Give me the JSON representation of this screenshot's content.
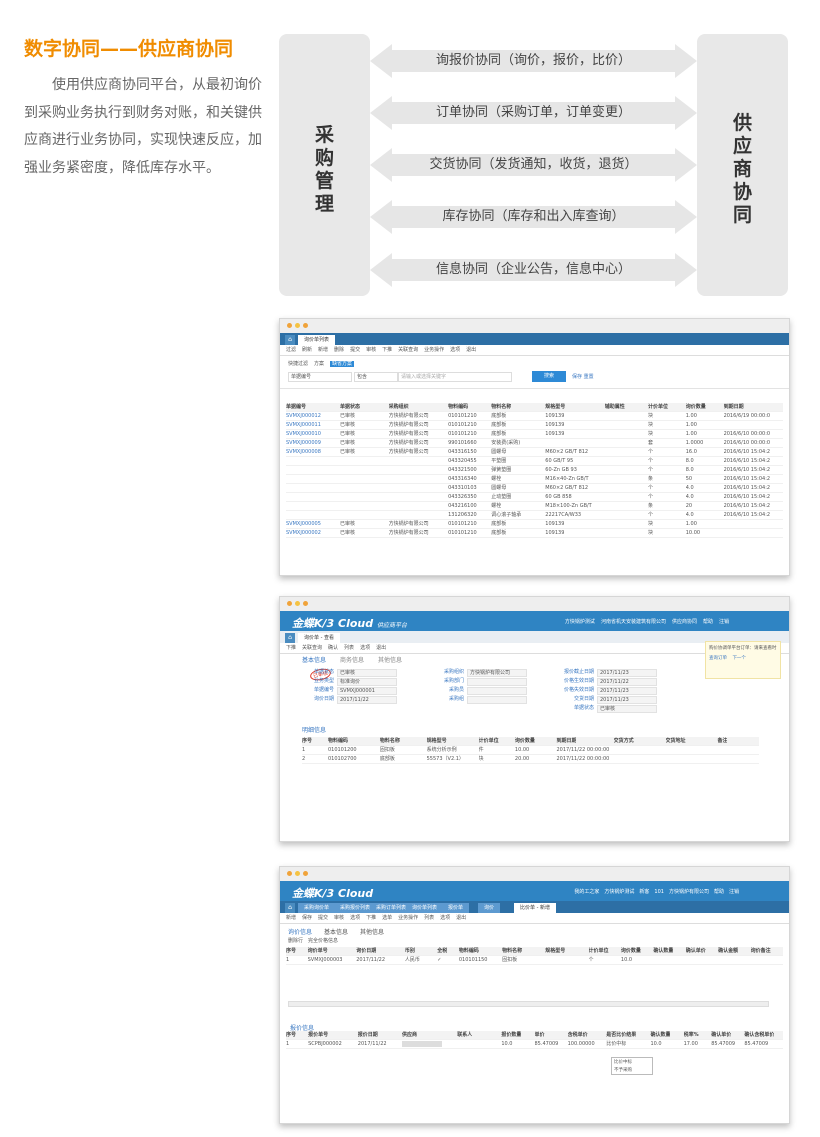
{
  "heading": "数字协同——供应商协同",
  "intro": "使用供应商协同平台，从最初询价到采购业务执行到财务对账，和关键供应商进行业务协同，实现快速反应，加强业务紧密度，降低库存水平。",
  "diagram": {
    "left_label": [
      "采",
      "购",
      "管",
      "理"
    ],
    "right_label": [
      "供",
      "应",
      "商",
      "协",
      "同"
    ],
    "arrows": [
      "询报价协同（询价，报价，比价）",
      "订单协同（采购订单，订单变更）",
      "交货协同（发货通知，收货，退货）",
      "库存协同（库存和出入库查询）",
      "信息协同（企业公告，信息中心）"
    ],
    "colors": {
      "box": "#e8e8e8",
      "arrow": "#e6e6e6",
      "heading": "#f08c00"
    }
  },
  "shot1": {
    "tab_label": "询价单列表",
    "toolbar": [
      "过滤",
      "刷新",
      "新增",
      "删除",
      "提交",
      "审核",
      "下推",
      "关联查询",
      "业务操作",
      "选项",
      "退出"
    ],
    "filter_tabs": [
      "快捷过滤",
      "方案",
      "缺省方案"
    ],
    "filter_field": "单据编号",
    "filter_op": "包含",
    "search_placeholder": "请输入或选择关键字",
    "search_button": "搜索",
    "search_links": [
      "保存",
      "重置"
    ],
    "columns": [
      "单据编号",
      "单据状态",
      "采购组织",
      "物料编码",
      "物料名称",
      "规格型号",
      "辅助属性",
      "计价单位",
      "询价数量",
      "到期日期"
    ],
    "rows": [
      [
        "SVMXJ000012",
        "已审核",
        "方快锅炉有限公司",
        "010101210",
        "底部板",
        "109139",
        "",
        "块",
        "1.00",
        "2016/6/19 00:00:0"
      ],
      [
        "SVMXJ000011",
        "已审核",
        "方快锅炉有限公司",
        "010101210",
        "底部板",
        "109139",
        "",
        "块",
        "1.00",
        ""
      ],
      [
        "SVMXJ000010",
        "已审核",
        "方快锅炉有限公司",
        "010101210",
        "底部板",
        "109139",
        "",
        "块",
        "1.00",
        "2016/6/10 00:00:0"
      ],
      [
        "SVMXJ000009",
        "已审核",
        "方快锅炉有限公司",
        "990101660",
        "安装费(采购)",
        "",
        "",
        "套",
        "1.0000",
        "2016/6/10 00:00:0"
      ],
      [
        "SVMXJ000008",
        "已审核",
        "方快锅炉有限公司",
        "043316150",
        "圆螺母",
        "M60×2 GB/T 812",
        "",
        "个",
        "16.0",
        "2016/6/10 15:04:2"
      ],
      [
        "",
        "",
        "",
        "043320455",
        "平垫圈",
        "60 GB/T 95",
        "",
        "个",
        "8.0",
        "2016/6/10 15:04:2"
      ],
      [
        "",
        "",
        "",
        "043321500",
        "弹簧垫圈",
        "60-Zn GB 93",
        "",
        "个",
        "8.0",
        "2016/6/10 15:04:2"
      ],
      [
        "",
        "",
        "",
        "043316340",
        "螺栓",
        "M16×40-Zn GB/T",
        "",
        "条",
        "50",
        "2016/6/10 15:04:2"
      ],
      [
        "",
        "",
        "",
        "043310103",
        "圆螺母",
        "M60×2 GB/T 812",
        "",
        "个",
        "4.0",
        "2016/6/10 15:04:2"
      ],
      [
        "",
        "",
        "",
        "043326350",
        "止动垫圈",
        "60  GB 858",
        "",
        "个",
        "4.0",
        "2016/6/10 15:04:2"
      ],
      [
        "",
        "",
        "",
        "043216100",
        "螺栓",
        "M18×100-Zn GB/T",
        "",
        "条",
        "20",
        "2016/6/10 15:04:2"
      ],
      [
        "",
        "",
        "",
        "131206320",
        "调心滚子轴承",
        "22217CA/W33",
        "",
        "个",
        "4.0",
        "2016/6/10 15:04:2"
      ],
      [
        "SVMXJ000005",
        "已审核",
        "方快锅炉有限公司",
        "010101210",
        "底部板",
        "109139",
        "",
        "块",
        "1.00",
        ""
      ],
      [
        "SVMXJ000002",
        "已审核",
        "方快锅炉有限公司",
        "010101210",
        "底部板",
        "109139",
        "",
        "块",
        "10.00",
        ""
      ]
    ]
  },
  "shot2": {
    "brand": "金蝶K/3 Cloud",
    "brand_sub": "供应商平台",
    "top_links": [
      "方快锅炉测试",
      "河南省机天安装建筑有限公司",
      "供应商协同",
      "帮助",
      "注销"
    ],
    "tab_label": "询价单 - 查看",
    "toolbar": [
      "下推",
      "关联查询",
      "确认",
      "列表",
      "选项",
      "退出"
    ],
    "section_tabs": [
      "基本信息",
      "商务信息",
      "其他信息"
    ],
    "stamp": "已审核",
    "fields_col1": [
      [
        "单据状态",
        "已审核"
      ],
      [
        "业务类型",
        "标准询价"
      ],
      [
        "单据编号",
        "SVMXJ000001"
      ],
      [
        "询价日期",
        "2017/11/22"
      ]
    ],
    "fields_col2": [
      [
        "采购组织",
        "方快锅炉有限公司"
      ],
      [
        "采购部门",
        ""
      ],
      [
        "采购员",
        ""
      ],
      [
        "采购组",
        ""
      ]
    ],
    "fields_col3": [
      [
        "报价截止日期",
        "2017/11/23"
      ],
      [
        "价格生效日期",
        "2017/11/22"
      ],
      [
        "价格失效日期",
        "2017/11/23"
      ],
      [
        "交货日期",
        "2017/11/23"
      ],
      [
        "单据状态",
        "已审核"
      ]
    ],
    "side_note": "购价协调单平台订单：请来查看时",
    "side_links": [
      "查询订单",
      "下一个"
    ],
    "detail_label": "明细信息",
    "detail_columns": [
      "序号",
      "物料编码",
      "物料名称",
      "规格型号",
      "计价单位",
      "询价数量",
      "到期日期",
      "交货方式",
      "交货地址",
      "备注"
    ],
    "detail_rows": [
      [
        "1",
        "010101200",
        "固扣板",
        "系统分析示例",
        "件",
        "10.00",
        "2017/11/22 00:00:00",
        "",
        "",
        ""
      ],
      [
        "2",
        "010102700",
        "底部板",
        "55573（V2.1）",
        "块",
        "20.00",
        "2017/11/22 00:00:00",
        "",
        "",
        ""
      ]
    ]
  },
  "shot3": {
    "brand": "金蝶K/3 Cloud",
    "top_links": [
      "我的工之家",
      "方快锅炉测试",
      "新客",
      "101",
      "方快锅炉有限公司",
      "帮助",
      "注销"
    ],
    "tabs": [
      "采购询价单",
      "采购报价列表",
      "采购订单列表",
      "询价单列表",
      "报价单",
      "询价",
      "比价单 - 新增"
    ],
    "toolbar": [
      "新增",
      "保存",
      "提交",
      "审核",
      "选项",
      "下推",
      "选单",
      "业务操作",
      "列表",
      "选项",
      "退出"
    ],
    "section_tabs": [
      "询价信息",
      "基本信息",
      "其他信息"
    ],
    "sub_toolbar": [
      "删除行",
      "完全价格信息"
    ],
    "grid1_columns": [
      "序号",
      "询价单号",
      "询价日期",
      "币别",
      "全税",
      "物料编码",
      "物料名称",
      "规格型号",
      "计价单位",
      "询价数量",
      "确认数量",
      "确认单价",
      "确认金额",
      "询价备注"
    ],
    "grid1_row": [
      "1",
      "SVMXJ000003",
      "2017/11/22",
      "人民币",
      "✓",
      "010101150",
      "固扣板",
      "",
      "个",
      "10.0",
      "",
      "",
      "",
      ""
    ],
    "grid2_label": "报价信息",
    "grid2_columns": [
      "序号",
      "报价单号",
      "报价日期",
      "供应商",
      "联系人",
      "报价数量",
      "单价",
      "含税单价",
      "是否比价结果",
      "确认数量",
      "税率%",
      "确认单价",
      "确认含税单价"
    ],
    "grid2_row": [
      "1",
      "SCPBJ000002",
      "2017/11/22",
      "",
      "",
      "10.0",
      "85.47009",
      "100.00000",
      "比价中标",
      "10.0",
      "17.00",
      "85.47009",
      "85.47009"
    ],
    "dropdown": [
      "比价中标",
      "不予采购"
    ]
  }
}
